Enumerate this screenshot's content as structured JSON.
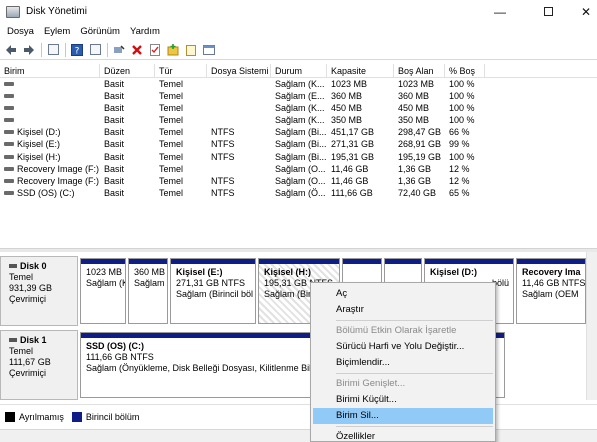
{
  "window": {
    "title": "Disk Yönetimi",
    "min_icon": "minimize-icon",
    "max_icon": "maximize-icon",
    "close_icon": "close-icon"
  },
  "menu": [
    "Dosya",
    "Eylem",
    "Görünüm",
    "Yardım"
  ],
  "toolbar": [
    "back-arrow-icon",
    "forward-arrow-icon",
    "console-tree-icon",
    "help-icon",
    "properties-icon",
    "connect-icon",
    "delete-icon",
    "check-icon",
    "add-folder-icon",
    "new-icon",
    "window-icon"
  ],
  "volume_table": {
    "columns": [
      "Birim",
      "Düzen",
      "Tür",
      "Dosya Sistemi",
      "Durum",
      "Kapasite",
      "Boş Alan",
      "% Boş"
    ],
    "rows": [
      [
        "",
        "Basit",
        "Temel",
        "",
        "Sağlam (K...",
        "1023 MB",
        "1023 MB",
        "100 %"
      ],
      [
        "",
        "Basit",
        "Temel",
        "",
        "Sağlam (E...",
        "360 MB",
        "360 MB",
        "100 %"
      ],
      [
        "",
        "Basit",
        "Temel",
        "",
        "Sağlam (K...",
        "450 MB",
        "450 MB",
        "100 %"
      ],
      [
        "",
        "Basit",
        "Temel",
        "",
        "Sağlam (K...",
        "350 MB",
        "350 MB",
        "100 %"
      ],
      [
        "Kişisel (D:)",
        "Basit",
        "Temel",
        "NTFS",
        "Sağlam (Bi...",
        "451,17 GB",
        "298,47 GB",
        "66 %"
      ],
      [
        "Kişisel (E:)",
        "Basit",
        "Temel",
        "NTFS",
        "Sağlam (Bi...",
        "271,31 GB",
        "268,91 GB",
        "99 %"
      ],
      [
        "Kişisel (H:)",
        "Basit",
        "Temel",
        "NTFS",
        "Sağlam (Bi...",
        "195,31 GB",
        "195,19 GB",
        "100 %"
      ],
      [
        "Recovery Image (F:)",
        "Basit",
        "Temel",
        "",
        "Sağlam (O...",
        "11,46 GB",
        "1,36 GB",
        "12 %"
      ],
      [
        "Recovery Image (F:)",
        "Basit",
        "Temel",
        "NTFS",
        "Sağlam (O...",
        "11,46 GB",
        "1,36 GB",
        "12 %"
      ],
      [
        "SSD (OS) (C:)",
        "Basit",
        "Temel",
        "NTFS",
        "Sağlam (Ö...",
        "111,66 GB",
        "72,40 GB",
        "65 %"
      ]
    ]
  },
  "disks": [
    {
      "name": "Disk 0",
      "type": "Temel",
      "size": "931,39 GB",
      "status": "Çevrimiçi",
      "partitions": [
        {
          "name": "",
          "size": "1023 MB",
          "status": "Sağlam (K"
        },
        {
          "name": "",
          "size": "360 MB",
          "status": "Sağlam"
        },
        {
          "name": "Kişisel (E:)",
          "size": "271,31 GB NTFS",
          "status": "Sağlam (Birincil böl"
        },
        {
          "name": "Kişisel (H:)",
          "size": "195,31 GB NTFS",
          "status": "Sağlam (Birincil bö"
        },
        {
          "name": "",
          "size": "",
          "status": ""
        },
        {
          "name": "",
          "size": "",
          "status": ""
        },
        {
          "name": "Kişisel (D:)",
          "size": "",
          "status": "bölü"
        },
        {
          "name": "Recovery Ima",
          "size": "11,46 GB NTFS",
          "status": "Sağlam (OEM"
        }
      ]
    },
    {
      "name": "Disk 1",
      "type": "Temel",
      "size": "111,67 GB",
      "status": "Çevrimiçi",
      "partitions": [
        {
          "name": "SSD (OS) (C:)",
          "size": "111,66 GB NTFS",
          "status": "Sağlam (Önyükleme, Disk Belleği Dosyası, Kilitlenme Bilgi"
        }
      ]
    }
  ],
  "legend": [
    {
      "label": "Ayrılmamış",
      "color": "#000000"
    },
    {
      "label": "Birincil bölüm",
      "color": "#0f1d87"
    }
  ],
  "context_menu": [
    {
      "label": "Aç",
      "disabled": false
    },
    {
      "label": "Araştır",
      "disabled": false
    },
    {
      "sep": true
    },
    {
      "label": "Bölümü Etkin Olarak İşaretle",
      "disabled": true
    },
    {
      "label": "Sürücü Harfi ve Yolu Değiştir...",
      "disabled": false
    },
    {
      "label": "Biçimlendir...",
      "disabled": false
    },
    {
      "sep": true
    },
    {
      "label": "Birimi Genişlet...",
      "disabled": true
    },
    {
      "label": "Birimi Küçült...",
      "disabled": false
    },
    {
      "label": "Birim Sil...",
      "disabled": false,
      "hover": true
    },
    {
      "sep": true
    },
    {
      "label": "Özellikler",
      "disabled": false
    }
  ]
}
